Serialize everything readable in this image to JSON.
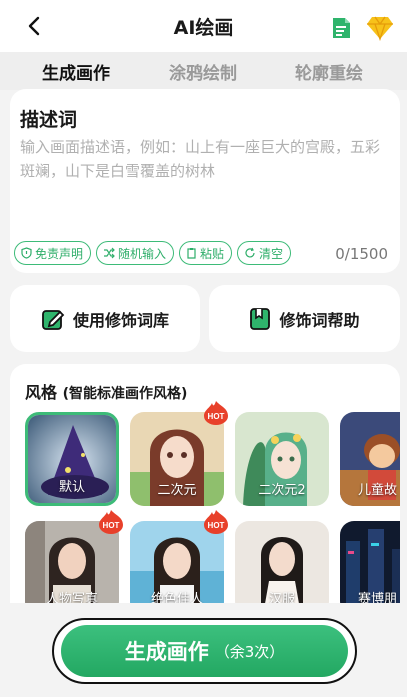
{
  "header": {
    "title": "AI绘画"
  },
  "tabs": [
    {
      "label": "生成画作"
    },
    {
      "label": "涂鸦绘制"
    },
    {
      "label": "轮廓重绘"
    }
  ],
  "description": {
    "title": "描述词",
    "placeholder": "输入画面描述语，例如：山上有一座巨大的宫殿，五彩斑斓，山下是白雪覆盖的树林",
    "chips": [
      "免责声明",
      "随机输入",
      "粘贴",
      "清空"
    ],
    "counter": "0/1500"
  },
  "actions": {
    "library": "使用修饰词库",
    "help": "修饰词帮助"
  },
  "styles": {
    "title": "风格",
    "subtitle": "(智能标准画作风格)",
    "items": [
      {
        "label": "默认",
        "hot": false,
        "selected": true
      },
      {
        "label": "二次元",
        "hot": true,
        "selected": false
      },
      {
        "label": "二次元2",
        "hot": false,
        "selected": false
      },
      {
        "label": "儿童故",
        "hot": false,
        "selected": false
      },
      {
        "label": "人物写真",
        "hot": true,
        "selected": false
      },
      {
        "label": "绝色佳人",
        "hot": true,
        "selected": false
      },
      {
        "label": "汉服",
        "hot": false,
        "selected": false
      },
      {
        "label": "赛博朋",
        "hot": false,
        "selected": false
      }
    ],
    "hot_badge": "HOT"
  },
  "generate": {
    "label": "生成画作",
    "remaining": "（余3次）"
  },
  "colors": {
    "accent": "#3dbb78",
    "hot": "#e8402a"
  }
}
